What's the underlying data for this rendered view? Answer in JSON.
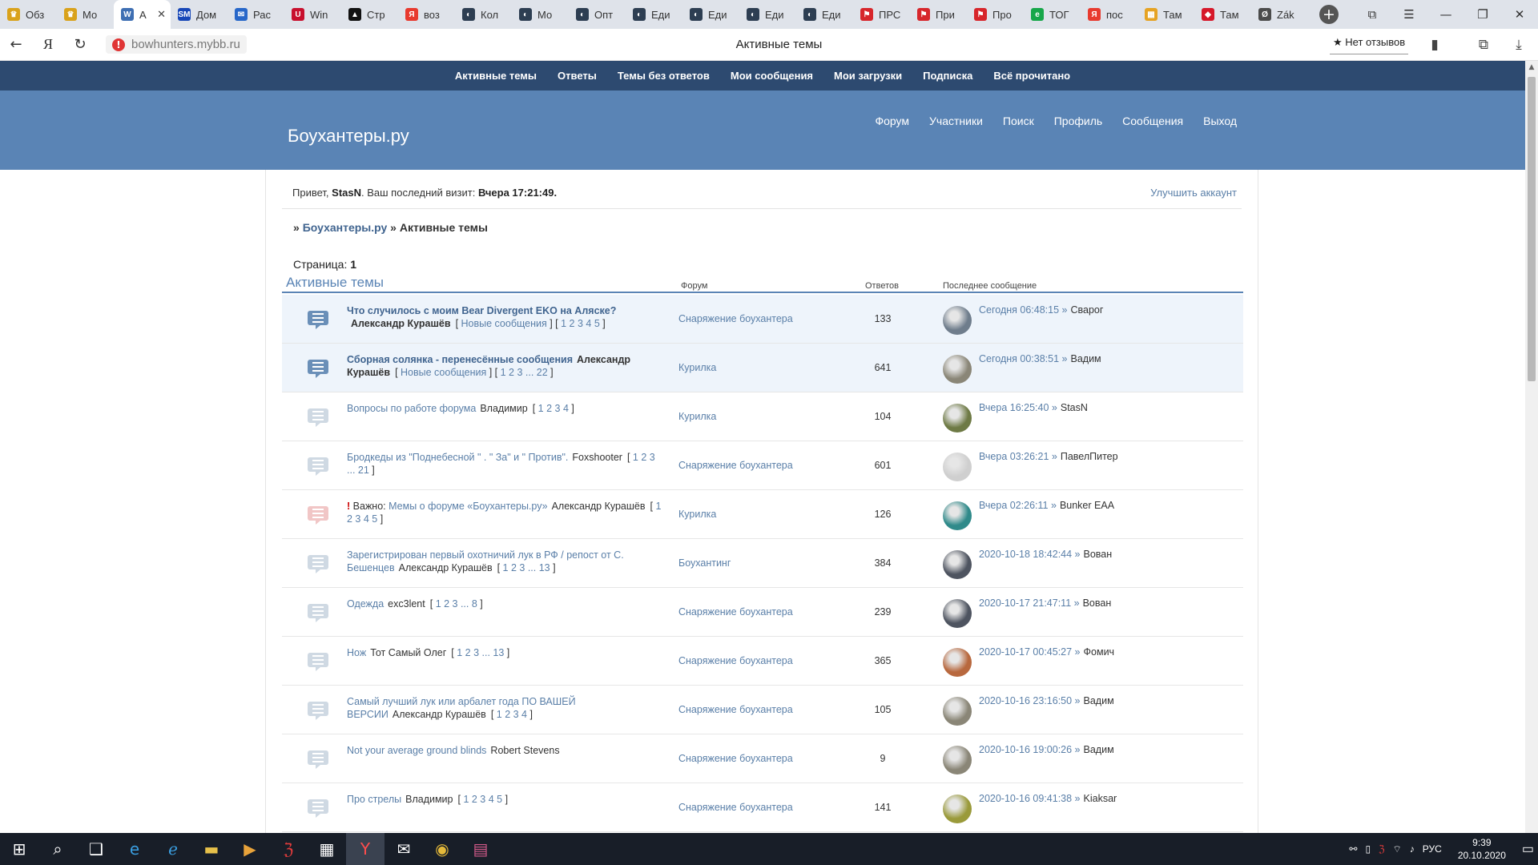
{
  "browser": {
    "tabs": [
      {
        "label": "Обз",
        "color": "#d9a21b",
        "glyph": "♛",
        "icon": "crest-icon"
      },
      {
        "label": "Мо",
        "color": "#d9a21b",
        "glyph": "♛",
        "icon": "crest-icon"
      },
      {
        "label": "А",
        "color": "#3e6fb3",
        "glyph": "W",
        "icon": "forum-icon",
        "active": true
      },
      {
        "label": "Дом",
        "color": "#1747b8",
        "glyph": "SM",
        "icon": "sm-icon"
      },
      {
        "label": "Рас",
        "color": "#2767c9",
        "glyph": "✉",
        "icon": "mail-icon"
      },
      {
        "label": "Win",
        "color": "#c8102e",
        "glyph": "U",
        "icon": "shield-icon"
      },
      {
        "label": "Стр",
        "color": "#111111",
        "glyph": "▲",
        "icon": "triangle-icon"
      },
      {
        "label": "воз",
        "color": "#e83a2e",
        "glyph": "Я",
        "icon": "yandex-icon"
      },
      {
        "label": "Кол",
        "color": "#2d3e52",
        "glyph": "◐",
        "icon": "circle-icon"
      },
      {
        "label": "Мо",
        "color": "#2d3e52",
        "glyph": "◐",
        "icon": "circle-icon"
      },
      {
        "label": "Опт",
        "color": "#2d3e52",
        "glyph": "◐",
        "icon": "circle-icon"
      },
      {
        "label": "Еди",
        "color": "#2d3e52",
        "glyph": "◐",
        "icon": "circle-icon"
      },
      {
        "label": "Еди",
        "color": "#2d3e52",
        "glyph": "◐",
        "icon": "circle-icon"
      },
      {
        "label": "Еди",
        "color": "#2d3e52",
        "glyph": "◐",
        "icon": "circle-icon"
      },
      {
        "label": "Еди",
        "color": "#2d3e52",
        "glyph": "◐",
        "icon": "circle-icon"
      },
      {
        "label": "ПРС",
        "color": "#d7262b",
        "glyph": "⚑",
        "icon": "flag-icon"
      },
      {
        "label": "При",
        "color": "#d7262b",
        "glyph": "⚑",
        "icon": "flag-icon"
      },
      {
        "label": "Про",
        "color": "#d7262b",
        "glyph": "⚑",
        "icon": "flag-icon"
      },
      {
        "label": "ТОГ",
        "color": "#17a74a",
        "glyph": "e",
        "icon": "e-icon"
      },
      {
        "label": "пос",
        "color": "#e83a2e",
        "glyph": "Я",
        "icon": "yandex-icon"
      },
      {
        "label": "Там",
        "color": "#e6a323",
        "glyph": "▦",
        "icon": "grid-icon"
      },
      {
        "label": "Там",
        "color": "#d6182a",
        "glyph": "◆",
        "icon": "gem-icon"
      },
      {
        "label": "Zák",
        "color": "#4b4b4b",
        "glyph": "Ø",
        "icon": "page-icon"
      }
    ],
    "url": "bowhunters.mybb.ru",
    "title": "Активные темы",
    "review_label": "★ Нет отзывов"
  },
  "forum": {
    "top_nav": [
      "Активные темы",
      "Ответы",
      "Темы без ответов",
      "Мои сообщения",
      "Мои загрузки",
      "Подписка",
      "Всё прочитано"
    ],
    "site_title": "Боухантеры.ру",
    "main_nav": [
      "Форум",
      "Участники",
      "Поиск",
      "Профиль",
      "Сообщения",
      "Выход"
    ],
    "welcome_prefix": "Привет,",
    "username": "StasN",
    "welcome_mid": ". Ваш последний визит:",
    "last_visit": "Вчера 17:21:49",
    "upgrade": "Улучшить аккаунт",
    "crumb_root": "Боухантеры.ру",
    "crumb_current": "Активные темы",
    "page_label": "Страница:",
    "page_num": "1",
    "section_title": "Активные темы",
    "col_forum": "Форум",
    "col_replies": "Ответов",
    "col_last": "Последнее сообщение"
  },
  "topics": [
    {
      "state": "unread",
      "title": "Что случилось с моим Bear Divergent EKO на Аляске?",
      "author": "Александр Курашёв",
      "new_label": "Новые сообщения",
      "pages": "1 2 3 4 5",
      "forum": "Снаряжение боухантера",
      "replies": "133",
      "last_time": "Сегодня 06:48:15",
      "last_user": "Сварог",
      "avatar_color": "#6f7d8c"
    },
    {
      "state": "unread",
      "title": "Сборная солянка - перенесённые сообщения",
      "author": "Александр Курашёв",
      "new_label": "Новые сообщения",
      "pages": "1 2 3 ... 22",
      "forum": "Курилка",
      "replies": "641",
      "last_time": "Сегодня 00:38:51",
      "last_user": "Вадим",
      "avatar_color": "#8a8677"
    },
    {
      "state": "read",
      "title": "Вопросы по работе форума",
      "author": "Владимир",
      "new_label": "",
      "pages": "1 2 3 4",
      "forum": "Курилка",
      "replies": "104",
      "last_time": "Вчера 16:25:40",
      "last_user": "StasN",
      "avatar_color": "#6e7a45"
    },
    {
      "state": "read",
      "title": "Бродкеды из \"Поднебесной \" . \" За\" и \" Против\".",
      "author": "Foxshooter",
      "new_label": "",
      "pages": "1 2 3 ... 21",
      "forum": "Снаряжение боухантера",
      "replies": "601",
      "last_time": "Вчера 03:26:21",
      "last_user": "ПавелПитер",
      "avatar_color": "#cfcfcf"
    },
    {
      "state": "important",
      "prefix": "Важно:",
      "title": "Мемы о форуме «Боухантеры.ру»",
      "author": "Александр Курашёв",
      "new_label": "",
      "pages": "1 2 3 4 5",
      "forum": "Курилка",
      "replies": "126",
      "last_time": "Вчера 02:26:11",
      "last_user": "Bunker EAA",
      "avatar_color": "#2f8a8a"
    },
    {
      "state": "read",
      "title": "Зарегистрирован первый охотничий лук в РФ / репост от С. Бешенцев",
      "author": "Александр Курашёв",
      "new_label": "",
      "pages": "1 2 3 ... 13",
      "forum": "Боухантинг",
      "replies": "384",
      "last_time": "2020-10-18 18:42:44",
      "last_user": "Вован",
      "avatar_color": "#4e5460"
    },
    {
      "state": "read",
      "title": "Одежда",
      "author": "exc3lent",
      "new_label": "",
      "pages": "1 2 3 ... 8",
      "forum": "Снаряжение боухантера",
      "replies": "239",
      "last_time": "2020-10-17 21:47:11",
      "last_user": "Вован",
      "avatar_color": "#4e5460"
    },
    {
      "state": "read",
      "title": "Нож",
      "author": "Тот Самый Олег",
      "new_label": "",
      "pages": "1 2 3 ... 13",
      "forum": "Снаряжение боухантера",
      "replies": "365",
      "last_time": "2020-10-17 00:45:27",
      "last_user": "Фомич",
      "avatar_color": "#b8683e"
    },
    {
      "state": "read",
      "title": "Самый лучший лук или арбалет года ПО ВАШЕЙ ВЕРСИИ",
      "author": "Александр Курашёв",
      "new_label": "",
      "pages": "1 2 3 4",
      "forum": "Снаряжение боухантера",
      "replies": "105",
      "last_time": "2020-10-16 23:16:50",
      "last_user": "Вадим",
      "avatar_color": "#8a8677"
    },
    {
      "state": "read",
      "title": "Not your average ground blinds",
      "author": "Robert Stevens",
      "new_label": "",
      "pages": "",
      "forum": "Снаряжение боухантера",
      "replies": "9",
      "last_time": "2020-10-16 19:00:26",
      "last_user": "Вадим",
      "avatar_color": "#8a8677"
    },
    {
      "state": "read",
      "title": "Про стрелы",
      "author": "Владимир",
      "new_label": "",
      "pages": "1 2 3 4 5",
      "forum": "Снаряжение боухантера",
      "replies": "141",
      "last_time": "2020-10-16 09:41:38",
      "last_user": "Kiaksar",
      "avatar_color": "#9a9a3a"
    }
  ],
  "taskbar": {
    "lang": "РУС",
    "time": "9:39",
    "date": "20.10.2020"
  }
}
